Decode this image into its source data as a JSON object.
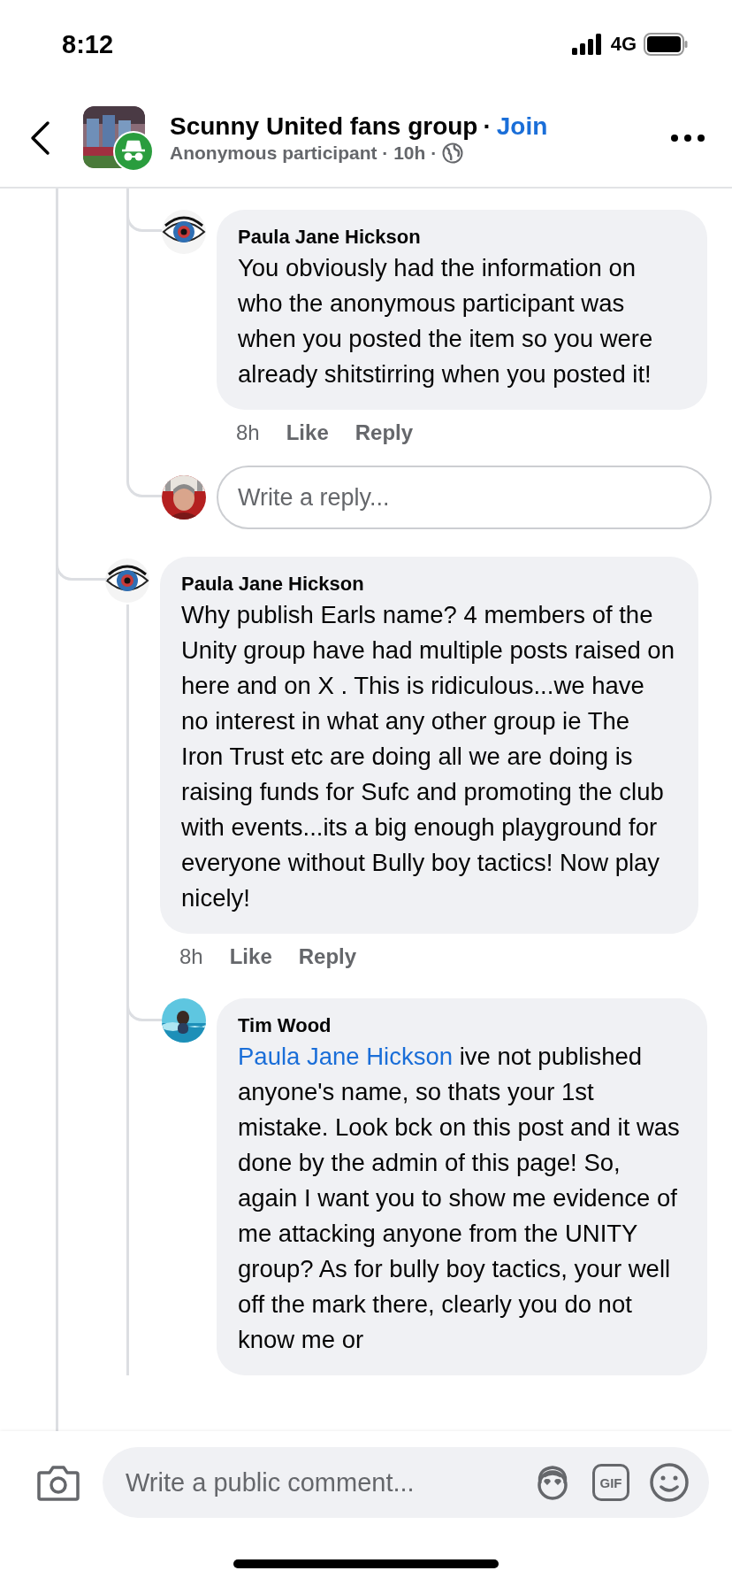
{
  "status_bar": {
    "time": "8:12",
    "network": "4G"
  },
  "header": {
    "title": "Scunny United fans group",
    "title_separator": "·",
    "join": "Join",
    "meta": "Anonymous participant · 10h ·"
  },
  "thread_above": {
    "replies": [
      {
        "author": "Paula Jane Hickson",
        "text": "You obviously had the information on who the anonymous participant was when you posted the item so you were already shitstirring when you posted it!",
        "time": "8h",
        "actions": [
          "Like",
          "Reply"
        ]
      }
    ],
    "reply_box": {
      "placeholder": "Write a reply..."
    }
  },
  "comments": [
    {
      "author": "Paula Jane Hickson",
      "text": "Why publish Earls name? 4 members of the Unity group have had multiple posts raised on here and on X .  This is ridiculous...we have no interest in what any other group ie The Iron Trust etc are doing all we are doing is raising funds for Sufc and promoting the club with events...its a big enough playground for everyone without Bully boy tactics! Now play nicely!",
      "time": "8h",
      "actions": [
        "Like",
        "Reply"
      ],
      "replies": [
        {
          "author": "Tim Wood",
          "mention": "Paula Jane Hickson",
          "text": "ive not published anyone's name, so thats your 1st mistake. Look bck on this post and it was done by the admin of this page! So, again I want you to show me evidence of me attacking anyone from the UNITY group?  As for bully boy tactics, your well off the mark there, clearly you do not know me or"
        }
      ]
    }
  ],
  "composer": {
    "placeholder": "Write a public comment...",
    "gif_label": "GIF"
  }
}
